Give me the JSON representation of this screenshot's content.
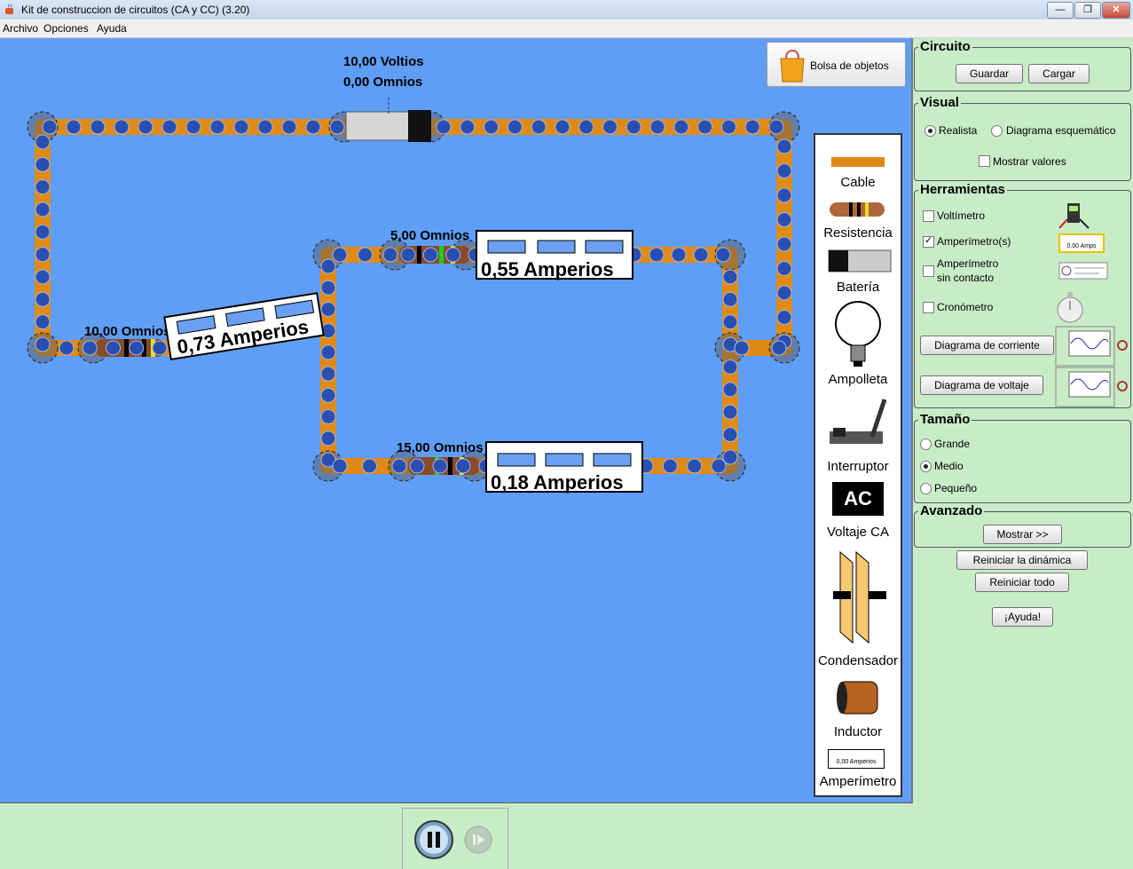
{
  "window": {
    "title": "Kit de construccion de circuitos (CA y CC) (3.20)",
    "minimize": "—",
    "maximize": "❐",
    "close": "✕"
  },
  "menu": [
    "Archivo",
    "Opciones",
    "Ayuda"
  ],
  "canvas": {
    "bag_button": "Bolsa de objetos",
    "battery_voltage": "10,00 Voltios",
    "battery_resistance": "0,00 Omnios",
    "resistors": [
      {
        "label": "10,00 Omnios"
      },
      {
        "label": "5,00 Omnios"
      },
      {
        "label": "15,00 Omnios"
      }
    ],
    "ammeters": [
      {
        "reading": "0,73 Amperios"
      },
      {
        "reading": "0,55 Amperios"
      },
      {
        "reading": "0,18 Amperios"
      }
    ]
  },
  "toolbox": {
    "items": [
      "Cable",
      "Resistencia",
      "Batería",
      "Ampolleta",
      "Interruptor",
      "Voltaje CA",
      "Condensador",
      "Inductor",
      "Amperímetro"
    ],
    "ac_icon_text": "AC",
    "ammeter_icon_text": "0,00 Amperios"
  },
  "panels": {
    "circuito": {
      "title": "Circuito",
      "save": "Guardar",
      "load": "Cargar"
    },
    "visual": {
      "title": "Visual",
      "realista": "Realista",
      "esquematico": "Diagrama esquemático",
      "mostrar_valores": "Mostrar valores",
      "selected": "Realista"
    },
    "herramientas": {
      "title": "Herramientas",
      "voltimetro": "Voltímetro",
      "amperimetro": "Amperímetro(s)",
      "amperimetro_sin_contacto_1": "Amperímetro",
      "amperimetro_sin_contacto_2": "sin contacto",
      "cronometro": "Cronómetro",
      "diagrama_corriente": "Diagrama de corriente",
      "diagrama_voltaje": "Diagrama de voltaje",
      "amperimetro_checked": true,
      "ammeter_icon_text": "0.00 Amps"
    },
    "tamano": {
      "title": "Tamaño",
      "grande": "Grande",
      "medio": "Medio",
      "pequeno": "Pequeño",
      "selected": "Medio"
    },
    "avanzado": {
      "title": "Avanzado",
      "mostrar": "Mostrar >>"
    },
    "reiniciar_dinamica": "Reiniciar la dinámica",
    "reiniciar_todo": "Reiniciar todo",
    "ayuda": "¡Ayuda!"
  },
  "colors": {
    "canvas": "#5f9ef7",
    "wire": "#e08a16",
    "electron": "#2a4fb0",
    "panel_bg": "#c8ecc6"
  }
}
